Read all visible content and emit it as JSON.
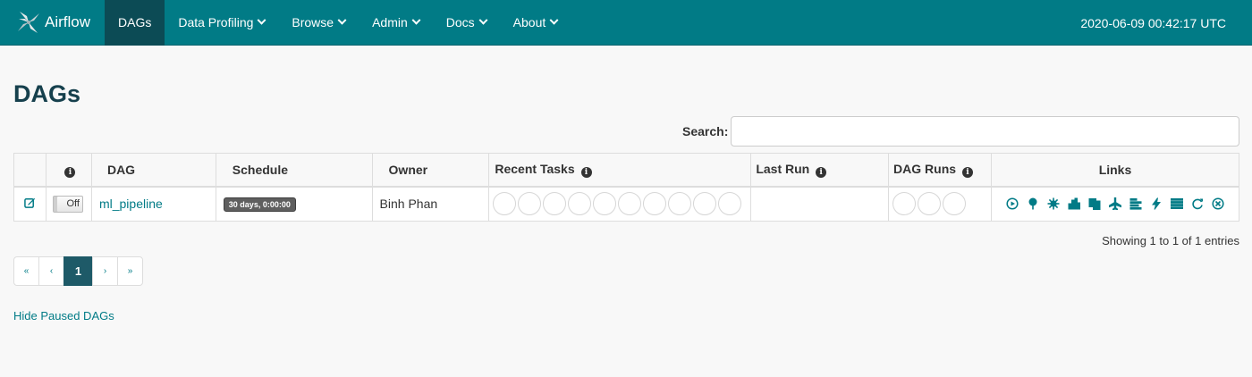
{
  "navbar": {
    "brand": "Airflow",
    "items": [
      {
        "label": "DAGs",
        "active": true,
        "dropdown": false
      },
      {
        "label": "Data Profiling",
        "active": false,
        "dropdown": true
      },
      {
        "label": "Browse",
        "active": false,
        "dropdown": true
      },
      {
        "label": "Admin",
        "active": false,
        "dropdown": true
      },
      {
        "label": "Docs",
        "active": false,
        "dropdown": true
      },
      {
        "label": "About",
        "active": false,
        "dropdown": true
      }
    ],
    "clock": "2020-06-09 00:42:17 UTC"
  },
  "page": {
    "title": "DAGs",
    "search_label": "Search:",
    "search_value": "",
    "search_placeholder": ""
  },
  "table": {
    "headers": {
      "info": "i",
      "dag": "DAG",
      "schedule": "Schedule",
      "owner": "Owner",
      "recent_tasks": "Recent Tasks",
      "last_run": "Last Run",
      "dag_runs": "DAG Runs",
      "links": "Links"
    },
    "rows": [
      {
        "toggle": "Off",
        "dag_id": "ml_pipeline",
        "schedule": "30 days, 0:00:00",
        "owner": "Binh Phan",
        "last_run": "",
        "recent_task_circles": 10,
        "dag_run_circles": 3
      }
    ],
    "link_icons": [
      "play-circle-icon",
      "tree-icon",
      "graph-icon",
      "bar-chart-icon",
      "duplicate-icon",
      "gantt-plane-icon",
      "align-left-icon",
      "flash-icon",
      "list-icon",
      "refresh-icon",
      "remove-circle-icon"
    ]
  },
  "entries_info": "Showing 1 to 1 of 1 entries",
  "pagination": {
    "first": "«",
    "prev": "‹",
    "current": "1",
    "next": "›",
    "last": "»"
  },
  "hide_paused": "Hide Paused DAGs",
  "colors": {
    "navbar": "#017b86",
    "navbar_active": "#0c4b55",
    "link": "#017b86",
    "title": "#16404d"
  }
}
